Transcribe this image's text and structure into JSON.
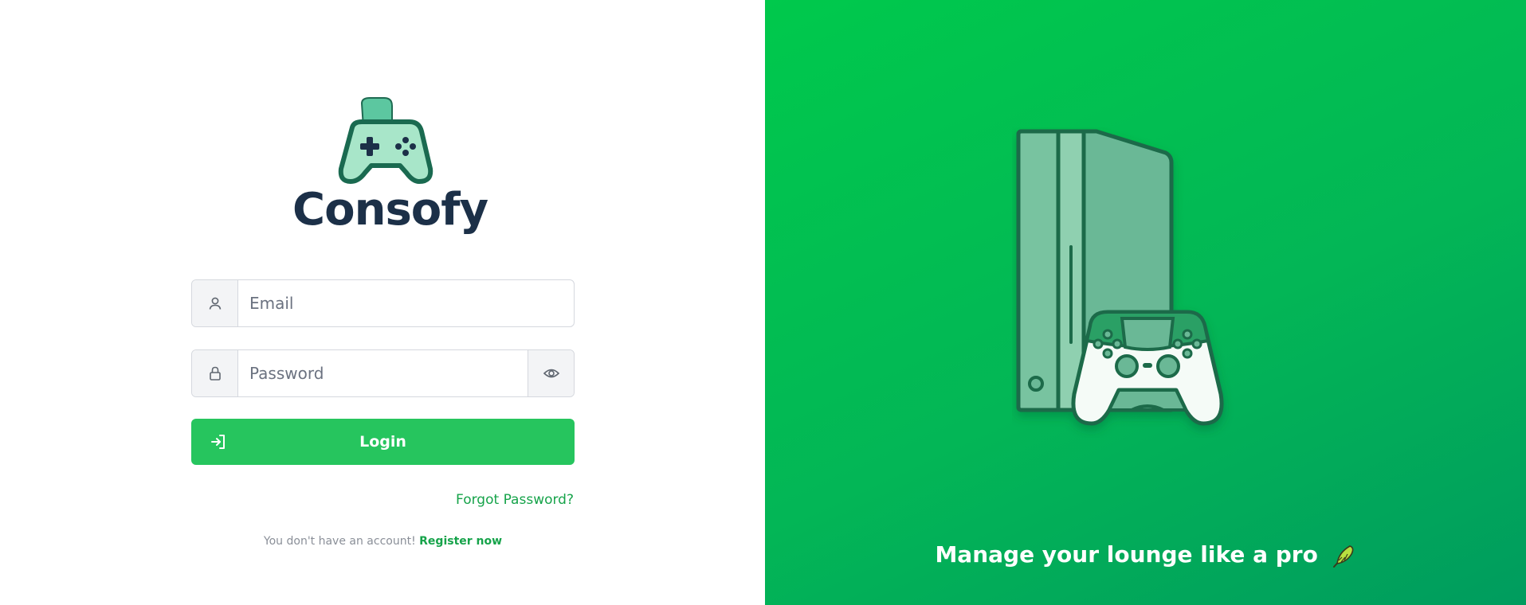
{
  "brand": {
    "name": "Consofy",
    "logo_icon": "gamepad-logo-icon"
  },
  "form": {
    "email": {
      "icon": "user-icon",
      "placeholder": "Email",
      "value": ""
    },
    "password": {
      "icon": "lock-icon",
      "placeholder": "Password",
      "value": "",
      "toggle_icon": "eye-icon"
    },
    "login_button": {
      "icon": "login-arrow-icon",
      "label": "Login"
    },
    "forgot_password": "Forgot Password?",
    "register": {
      "prompt": "You don't have an account!",
      "link": "Register now"
    }
  },
  "hero": {
    "illustration": "console-and-controller-illustration",
    "tagline": "Manage your lounge like a pro",
    "tagline_icon": "leaf-icon"
  },
  "colors": {
    "brand_dark": "#1c3048",
    "accent_green": "#26c55e",
    "link_green": "#16a34a",
    "hero_gradient_start": "#00c94c",
    "hero_gradient_end": "#009c5e"
  }
}
